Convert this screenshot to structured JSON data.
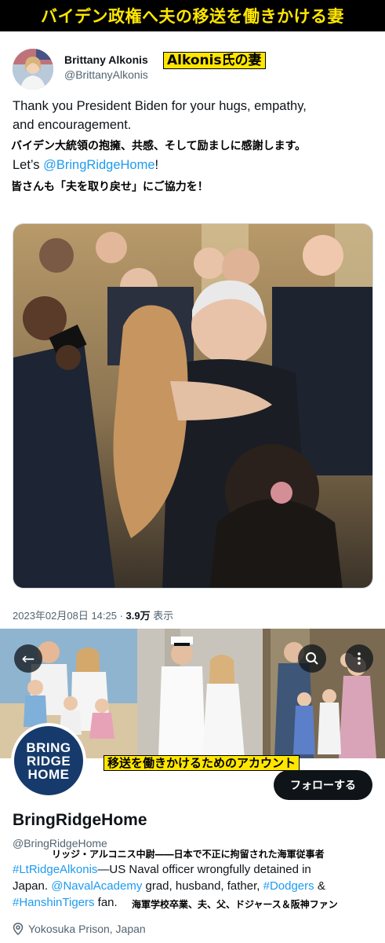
{
  "banner": {
    "title": "バイデン政権へ夫の移送を働きかける妻"
  },
  "tweet": {
    "author_name": "Brittany Alkonis",
    "author_handle": "@BrittanyAlkonis",
    "wife_label": "Alkonis氏の妻",
    "text_line1": "Thank you President Biden for your hugs, empathy,",
    "text_line2": "and encouragement.",
    "jp_caption1": "バイデン大統領の抱擁、共感、そして励ましに感謝します。",
    "text_line3_prefix": "Let’s ",
    "text_line3_link": "@BringRidgeHome",
    "text_line3_suffix": "!",
    "jp_caption2": "皆さんも「夫を取り戻せ」にご協力を！",
    "timestamp": "2023年02月08日 14:25 · ",
    "views": "3.9万",
    "views_label": " 表示"
  },
  "profile": {
    "avatar_lines": [
      "BRING",
      "RIDGE",
      "HOME"
    ],
    "account_label": "移送を働きかけるためのアカウント",
    "follow_label": "フォローする",
    "name": "BringRidgeHome",
    "handle": "@BringRidgeHome",
    "jp_bio1": "リッジ・アルコニス中尉――日本で不正に拘留された海軍従事者",
    "bio_line1_link": "#LtRidgeAlkonis",
    "bio_line1_text": "—US Naval officer wrongfully detained in",
    "bio_line2_text1": "Japan. ",
    "bio_line2_link1": "@NavalAcademy",
    "bio_line2_text2": " grad, husband, father, ",
    "bio_line2_link2": "#Dodgers",
    "bio_line2_text3": " &",
    "bio_line3_link": "#HanshinTigers",
    "bio_line3_text": " fan.",
    "jp_bio2": "海軍学校卒業、夫、父、ドジャース＆阪神ファン",
    "location": "Yokosuka Prison, Japan"
  },
  "icons": {
    "back": "arrow-left-icon",
    "search": "search-icon",
    "more": "more-icon",
    "location": "location-pin-icon"
  },
  "colors": {
    "link": "#1d9bf0",
    "highlight": "#ffe600",
    "follow_bg": "#0f1419"
  }
}
